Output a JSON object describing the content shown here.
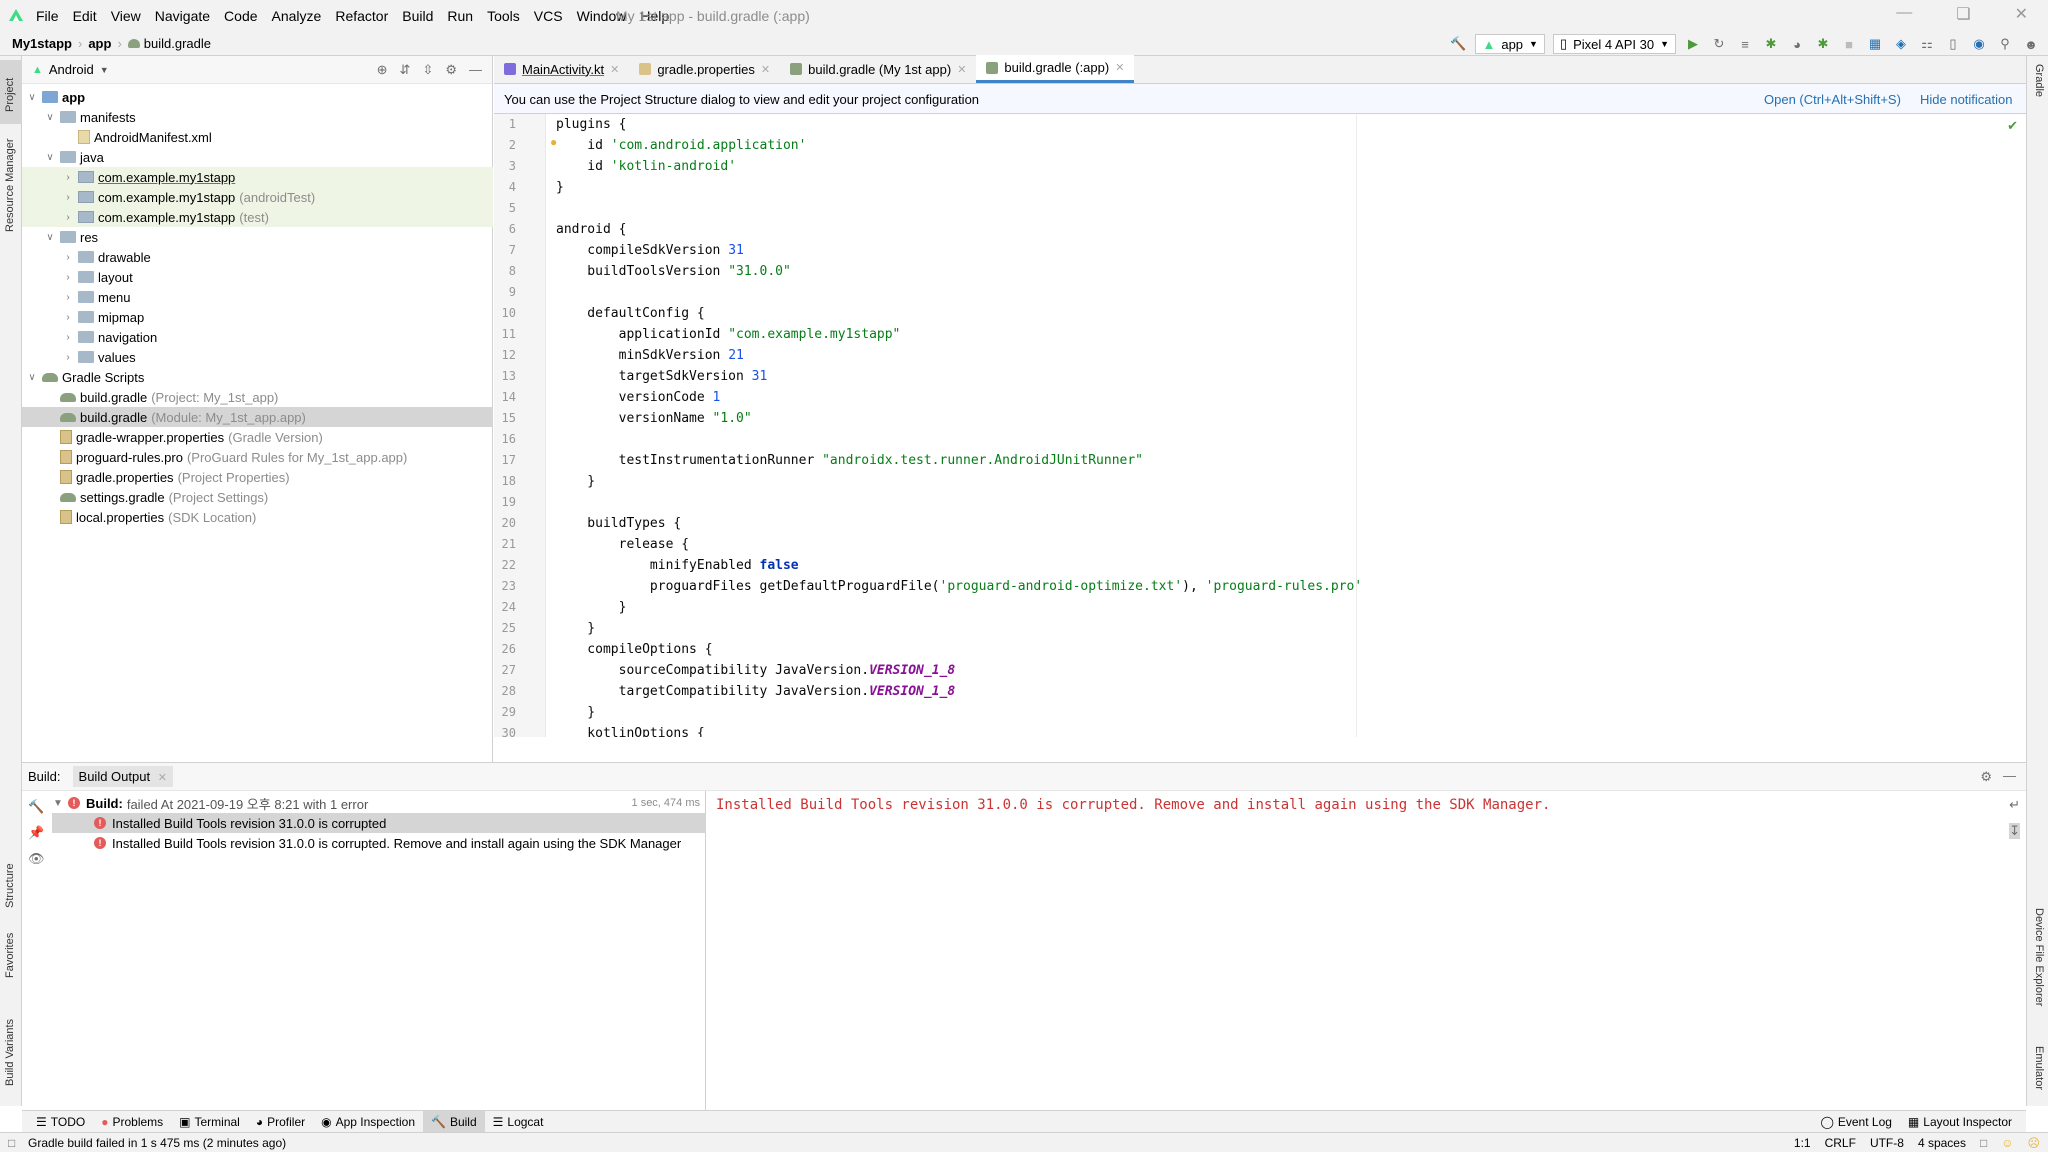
{
  "menubar": {
    "items": [
      "File",
      "Edit",
      "View",
      "Navigate",
      "Code",
      "Analyze",
      "Refactor",
      "Build",
      "Run",
      "Tools",
      "VCS",
      "Window",
      "Help"
    ],
    "window_title": "My 1st app - build.gradle (:app)"
  },
  "navbar": {
    "crumbs": [
      "My1stapp",
      "app",
      "build.gradle"
    ],
    "run_config": "app",
    "device": "Pixel 4 API 30"
  },
  "left_stripe": {
    "project": "Project",
    "resource_manager": "Resource Manager",
    "structure": "Structure",
    "favorites": "Favorites",
    "build_variants": "Build Variants"
  },
  "right_stripe": {
    "gradle": "Gradle",
    "device_file_explorer": "Device File Explorer",
    "emulator": "Emulator"
  },
  "project": {
    "view": "Android",
    "tree": [
      {
        "label": "app",
        "suffix": "",
        "depth": 0,
        "expanded": true,
        "icon": "folder-blue"
      },
      {
        "label": "manifests",
        "suffix": "",
        "depth": 1,
        "expanded": true,
        "icon": "folder"
      },
      {
        "label": "AndroidManifest.xml",
        "suffix": "",
        "depth": 2,
        "expanded": null,
        "icon": "xml"
      },
      {
        "label": "java",
        "suffix": "",
        "depth": 1,
        "expanded": true,
        "icon": "folder"
      },
      {
        "label": "com.example.my1stapp",
        "suffix": "",
        "depth": 2,
        "expanded": false,
        "icon": "pkg"
      },
      {
        "label": "com.example.my1stapp",
        "suffix": "(androidTest)",
        "depth": 2,
        "expanded": false,
        "icon": "pkg"
      },
      {
        "label": "com.example.my1stapp",
        "suffix": "(test)",
        "depth": 2,
        "expanded": false,
        "icon": "pkg"
      },
      {
        "label": "res",
        "suffix": "",
        "depth": 1,
        "expanded": true,
        "icon": "folder"
      },
      {
        "label": "drawable",
        "suffix": "",
        "depth": 2,
        "expanded": false,
        "icon": "folder"
      },
      {
        "label": "layout",
        "suffix": "",
        "depth": 2,
        "expanded": false,
        "icon": "folder"
      },
      {
        "label": "menu",
        "suffix": "",
        "depth": 2,
        "expanded": false,
        "icon": "folder"
      },
      {
        "label": "mipmap",
        "suffix": "",
        "depth": 2,
        "expanded": false,
        "icon": "folder"
      },
      {
        "label": "navigation",
        "suffix": "",
        "depth": 2,
        "expanded": false,
        "icon": "folder"
      },
      {
        "label": "values",
        "suffix": "",
        "depth": 2,
        "expanded": false,
        "icon": "folder"
      },
      {
        "label": "Gradle Scripts",
        "suffix": "",
        "depth": 0,
        "expanded": true,
        "icon": "gradle"
      },
      {
        "label": "build.gradle",
        "suffix": "(Project: My_1st_app)",
        "depth": 1,
        "expanded": null,
        "icon": "gradle"
      },
      {
        "label": "build.gradle",
        "suffix": "(Module: My_1st_app.app)",
        "depth": 1,
        "expanded": null,
        "icon": "gradle"
      },
      {
        "label": "gradle-wrapper.properties",
        "suffix": "(Gradle Version)",
        "depth": 1,
        "expanded": null,
        "icon": "prop"
      },
      {
        "label": "proguard-rules.pro",
        "suffix": "(ProGuard Rules for My_1st_app.app)",
        "depth": 1,
        "expanded": null,
        "icon": "prop"
      },
      {
        "label": "gradle.properties",
        "suffix": "(Project Properties)",
        "depth": 1,
        "expanded": null,
        "icon": "prop"
      },
      {
        "label": "settings.gradle",
        "suffix": "(Project Settings)",
        "depth": 1,
        "expanded": null,
        "icon": "gradle"
      },
      {
        "label": "local.properties",
        "suffix": "(SDK Location)",
        "depth": 1,
        "expanded": null,
        "icon": "prop"
      }
    ]
  },
  "tabs": [
    {
      "label": "MainActivity.kt",
      "active": false
    },
    {
      "label": "gradle.properties",
      "active": false
    },
    {
      "label": "build.gradle (My 1st app)",
      "active": false
    },
    {
      "label": "build.gradle (:app)",
      "active": true
    }
  ],
  "notification": {
    "message": "You can use the Project Structure dialog to view and edit your project configuration",
    "open_link": "Open (Ctrl+Alt+Shift+S)",
    "hide_link": "Hide notification"
  },
  "code_lines": [
    "plugins {",
    "    id 'com.android.application'",
    "    id 'kotlin-android'",
    "}",
    "",
    "android {",
    "    compileSdkVersion 31",
    "    buildToolsVersion \"31.0.0\"",
    "",
    "    defaultConfig {",
    "        applicationId \"com.example.my1stapp\"",
    "        minSdkVersion 21",
    "        targetSdkVersion 31",
    "        versionCode 1",
    "        versionName \"1.0\"",
    "",
    "        testInstrumentationRunner \"androidx.test.runner.AndroidJUnitRunner\"",
    "    }",
    "",
    "    buildTypes {",
    "        release {",
    "            minifyEnabled false",
    "            proguardFiles getDefaultProguardFile('proguard-android-optimize.txt'), 'proguard-rules.pro'",
    "        }",
    "    }",
    "    compileOptions {",
    "        sourceCompatibility JavaVersion.VERSION_1_8",
    "        targetCompatibility JavaVersion.VERSION_1_8",
    "    }",
    "    kotlinOptions {"
  ],
  "build": {
    "label": "Build:",
    "tab": "Build Output",
    "summary_bold": "Build:",
    "summary_rest": "failed At 2021-09-19 오후 8:21 with 1 error",
    "duration": "1 sec, 474 ms",
    "errors": [
      "Installed Build Tools revision 31.0.0 is corrupted",
      "Installed Build Tools revision 31.0.0 is corrupted. Remove and install again using the SDK Manager"
    ],
    "output": "Installed Build Tools revision 31.0.0 is corrupted. Remove and install again using the SDK Manager."
  },
  "bottom_tools": [
    "TODO",
    "Problems",
    "Terminal",
    "Profiler",
    "App Inspection",
    "Build",
    "Logcat"
  ],
  "bottom_right_tools": [
    "Event Log",
    "Layout Inspector"
  ],
  "status": {
    "message": "Gradle build failed in 1 s 475 ms (2 minutes ago)",
    "position": "1:1",
    "line_sep": "CRLF",
    "encoding": "UTF-8",
    "indent": "4 spaces"
  },
  "colors": {
    "accent": "#4083c9",
    "error": "#e55b5b",
    "selection": "#d5d5d5"
  }
}
